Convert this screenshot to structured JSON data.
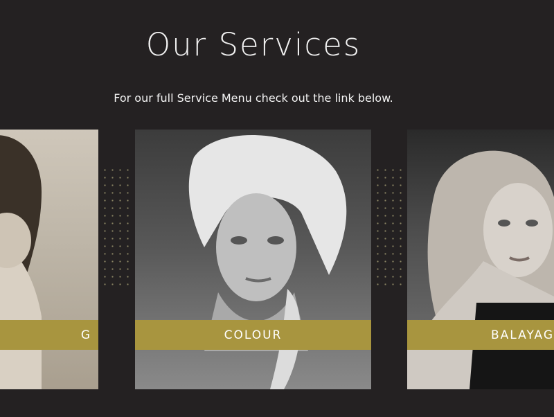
{
  "header": {
    "title": "Our Services",
    "subtitle": "For our full Service Menu check out the link below."
  },
  "services": [
    {
      "label": "G"
    },
    {
      "label": "COLOUR"
    },
    {
      "label": "BALAYAGE"
    }
  ],
  "colors": {
    "background": "#242122",
    "accent": "#a8953f"
  }
}
